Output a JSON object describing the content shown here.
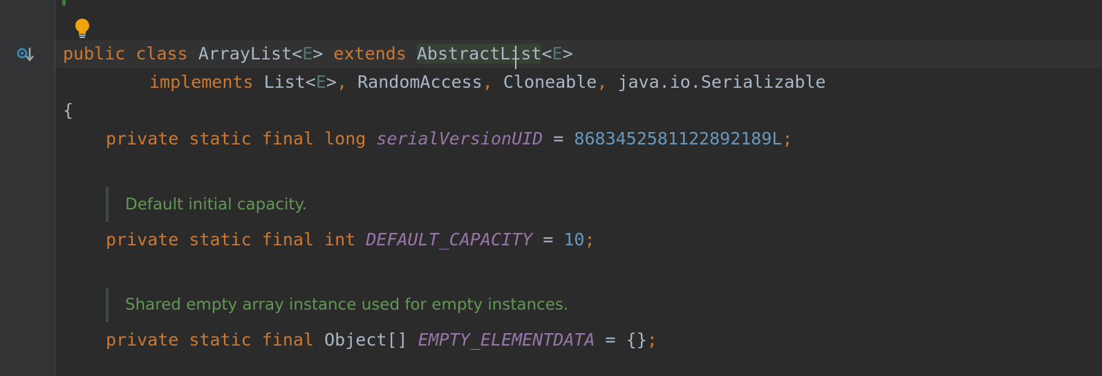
{
  "editor": {
    "lines": {
      "class_decl": {
        "kw_public": "public",
        "kw_class": "class",
        "class_name": "ArrayList",
        "lt1": "<",
        "tparam1": "E",
        "gt1": ">",
        "kw_extends": "extends",
        "super_name": "AbstractList",
        "lt2": "<",
        "tparam2": "E",
        "gt2": ">"
      },
      "implements": {
        "kw_implements": "implements",
        "iface1": "List",
        "lt": "<",
        "tparam": "E",
        "gt": ">",
        "comma1": ",",
        "iface2": "RandomAccess",
        "comma2": ",",
        "iface3": "Cloneable",
        "comma3": ",",
        "iface4": "java.io.Serializable"
      },
      "brace_open": "{",
      "serial": {
        "kw_private": "private",
        "kw_static": "static",
        "kw_final": "final",
        "kw_type": "long",
        "name": "serialVersionUID",
        "eq": "=",
        "value": "8683452581122892189L",
        "semi": ";"
      },
      "doc1": "Default initial capacity.",
      "capacity": {
        "kw_private": "private",
        "kw_static": "static",
        "kw_final": "final",
        "kw_type": "int",
        "name": "DEFAULT_CAPACITY",
        "eq": "=",
        "value": "10",
        "semi": ";"
      },
      "doc2": "Shared empty array instance used for empty instances.",
      "empty": {
        "kw_private": "private",
        "kw_static": "static",
        "kw_final": "final",
        "type": "Object[]",
        "name": "EMPTY_ELEMENTDATA",
        "eq": "=",
        "value": "{}",
        "semi": ";"
      }
    },
    "icons": {
      "intention": "lightbulb-icon",
      "gutter": "implemented-method-down-icon"
    },
    "colors": {
      "keyword": "#cc7832",
      "identifier": "#a9b7c6",
      "type_param": "#507874",
      "constant": "#9876aa",
      "number": "#6897bb",
      "doc_comment": "#629755",
      "background": "#2b2b2b",
      "gutter": "#313335"
    }
  }
}
